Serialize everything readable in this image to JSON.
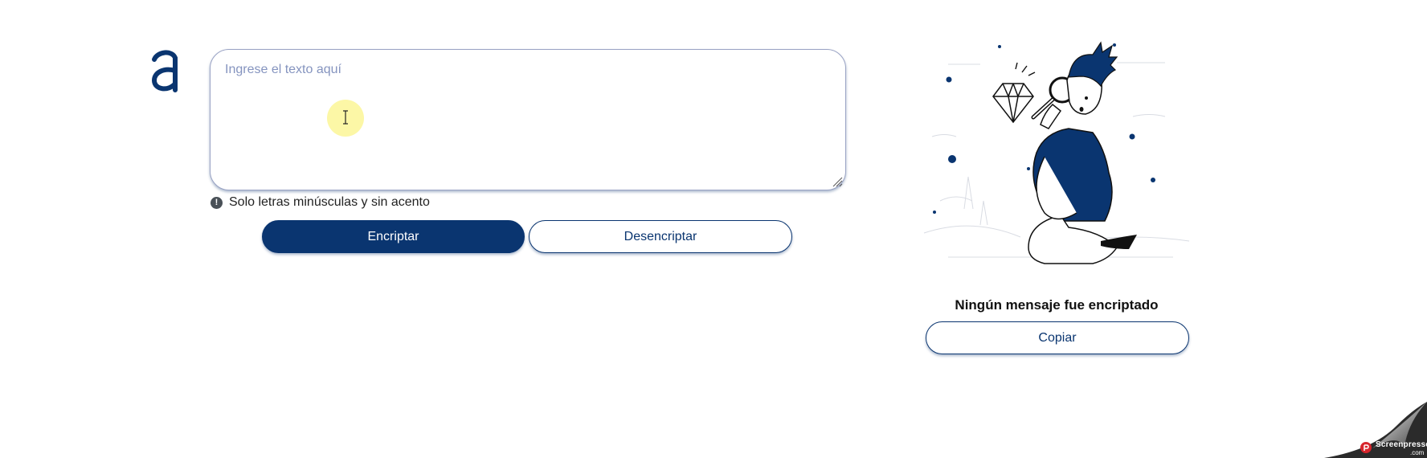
{
  "brand": {
    "logo_icon": "alura-a-logo-icon",
    "color": "#0a3570"
  },
  "input": {
    "placeholder": "Ingrese el texto aquí",
    "value": ""
  },
  "hint": {
    "icon": "exclamation-circle-icon",
    "text": "Solo letras minúsculas y sin acento"
  },
  "actions": {
    "encrypt_label": "Encriptar",
    "decrypt_label": "Desencriptar"
  },
  "output": {
    "illustration": "person-with-magnifying-glass-diamond-illustration",
    "title": "Ningún mensaje fue encriptado",
    "copy_label": "Copiar"
  },
  "watermark": {
    "brand": "Screenpresso",
    "suffix": ".com"
  },
  "colors": {
    "primary": "#0a3570",
    "placeholder": "#8594bf",
    "background": "#ffffff"
  }
}
